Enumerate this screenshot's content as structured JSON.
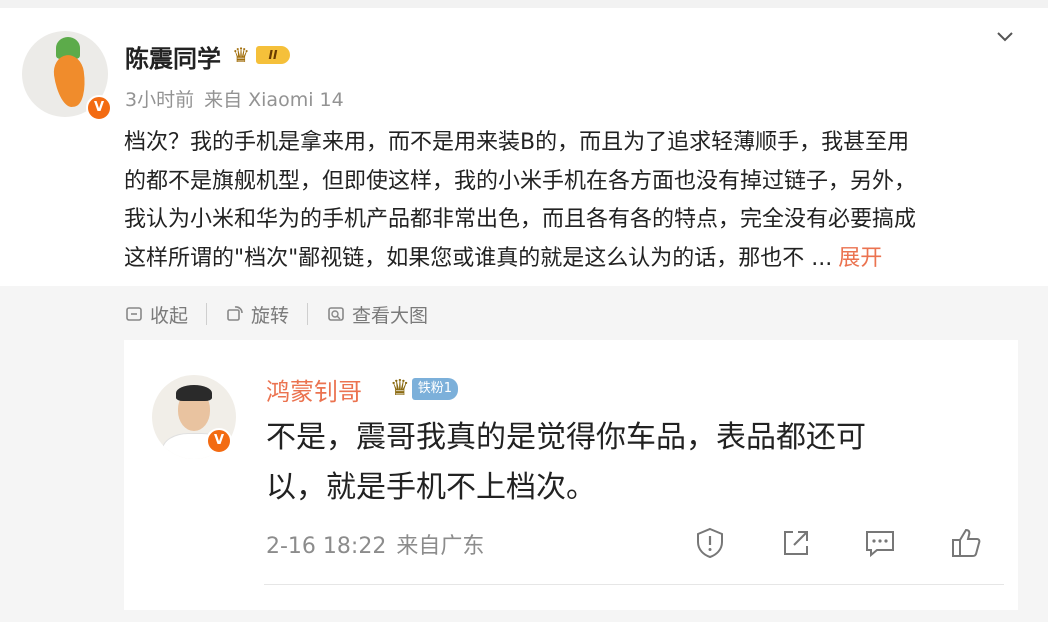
{
  "post": {
    "author": "陈震同学",
    "level_badge": "II",
    "time": "3小时前",
    "source": "来自 Xiaomi 14",
    "text_lines": [
      "档次？我的手机是拿来用，而不是用来装B的，而且为了追求轻薄顺手，我甚至用",
      "的都不是旗舰机型，但即使这样，我的小米手机在各方面也没有掉过链子，另外，",
      "我认为小米和华为的手机产品都非常出色，而且各有各的特点，完全没有必要搞成",
      "这样所谓的\"档次\"鄙视链，如果您或谁真的就是这么认为的话，那也不 ..."
    ],
    "expand_label": "展开",
    "verified_mark": "V"
  },
  "toolbar": {
    "collapse_label": "收起",
    "rotate_label": "旋转",
    "view_large_label": "查看大图"
  },
  "comment": {
    "author": "鸿蒙钊哥",
    "fan_badge": "铁粉1",
    "text_lines": [
      "不是，震哥我真的是觉得你车品，表品都还可",
      "以，就是手机不上档次。"
    ],
    "date": "2-16 18:22",
    "location": "来自广东",
    "verified_mark": "V"
  },
  "icons": {
    "report": "shield-alert-icon",
    "share": "share-icon",
    "comment": "comment-icon",
    "like": "thumbs-up-icon"
  },
  "colors": {
    "accent": "#eb7350",
    "verified": "#f36b12",
    "meta_gray": "#939393"
  }
}
